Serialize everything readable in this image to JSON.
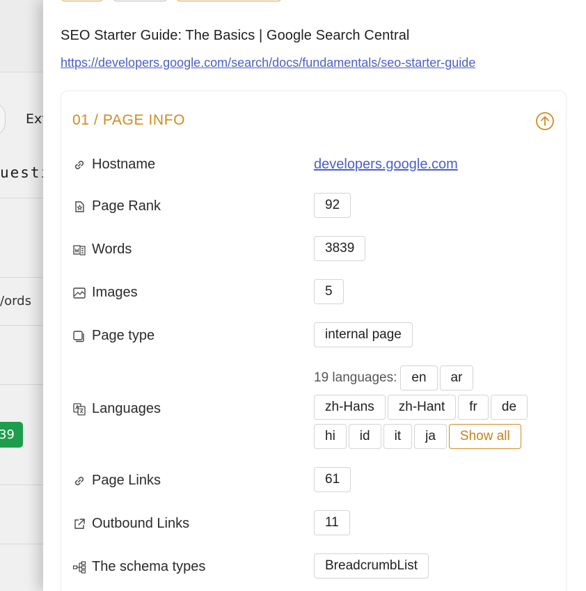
{
  "background": {
    "tab_partial": "Ext",
    "heading_partial": "uesti",
    "words_partial": "/ords",
    "badge_partial": "39"
  },
  "page": {
    "title": "SEO Starter Guide: The Basics | Google Search Central",
    "url": "https://developers.google.com/search/docs/fundamentals/seo-starter-guide"
  },
  "section": {
    "title": "01 / PAGE INFO",
    "rows": {
      "hostname": {
        "label": "Hostname",
        "value": "developers.google.com"
      },
      "page_rank": {
        "label": "Page Rank",
        "value": "92"
      },
      "words": {
        "label": "Words",
        "value": "3839"
      },
      "images": {
        "label": "Images",
        "value": "5"
      },
      "page_type": {
        "label": "Page type",
        "value": "internal page"
      },
      "languages": {
        "label": "Languages",
        "prefix": "19 languages:",
        "items": [
          "en",
          "ar",
          "zh-Hans",
          "zh-Hant",
          "fr",
          "de",
          "hi",
          "id",
          "it",
          "ja"
        ],
        "show_all": "Show all"
      },
      "page_links": {
        "label": "Page Links",
        "value": "61"
      },
      "outbound_links": {
        "label": "Outbound Links",
        "value": "11"
      },
      "schema_types": {
        "label": "The schema types",
        "value": "BreadcrumbList"
      }
    }
  },
  "colors": {
    "accent": "#d28a1f",
    "link": "#4a5fc9",
    "badge_green": "#1e9e4c"
  }
}
